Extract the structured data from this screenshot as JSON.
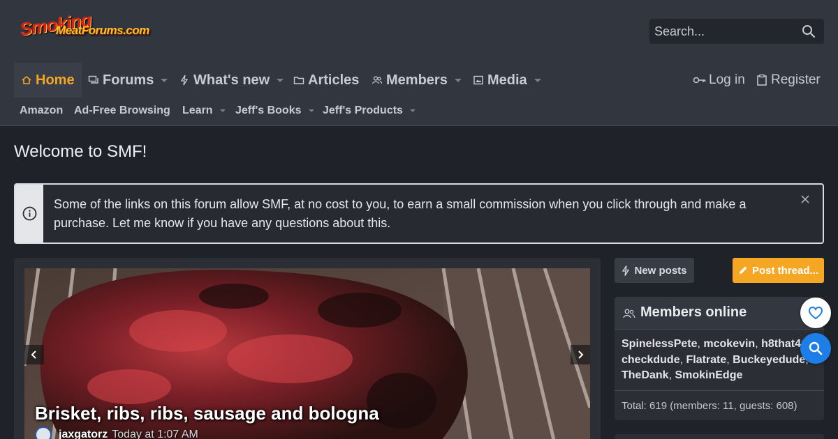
{
  "header": {
    "logo_line1": "Smoking",
    "logo_line2": "MeatForums.com",
    "search_placeholder": "Search..."
  },
  "nav": {
    "home": "Home",
    "forums": "Forums",
    "whats_new": "What's new",
    "articles": "Articles",
    "members": "Members",
    "media": "Media",
    "login": "Log in",
    "register": "Register"
  },
  "subnav": {
    "amazon": "Amazon",
    "adfree": "Ad-Free Browsing",
    "learn": "Learn",
    "books": "Jeff's Books",
    "products": "Jeff's Products"
  },
  "page": {
    "title": "Welcome to SMF!"
  },
  "notice": {
    "text": "Some of the links on this forum allow SMF, at no cost to you, to earn a small commission when you click through and make a purchase. Let me know if you have any questions about this."
  },
  "slider": {
    "title": "Brisket, ribs, ribs, sausage and bologna",
    "author": "jaxgatorz",
    "time": "Today at 1:07 AM"
  },
  "sidebar": {
    "new_posts": "New posts",
    "post_thread": "Post thread...",
    "members_online": {
      "title": "Members online",
      "names": [
        "SpinelessPete",
        "mcokevin",
        "h8that4u",
        "checkdude",
        "Flatrate",
        "Buckeyedude",
        "TheDank",
        "SmokinEdge"
      ],
      "total": "Total: 619 (members: 11, guests: 608)"
    }
  },
  "colors": {
    "accent": "#f5a623",
    "header_bg": "#32363f",
    "page_bg": "#1f2228",
    "fab_blue": "#1e7ee8"
  },
  "icons": [
    "home-icon",
    "forums-icon",
    "bolt-icon",
    "articles-icon",
    "members-icon",
    "media-icon",
    "key-icon",
    "clipboard-icon",
    "search-icon",
    "info-icon",
    "close-icon",
    "chevron-left-icon",
    "chevron-right-icon",
    "pencil-icon",
    "heart-icon"
  ]
}
